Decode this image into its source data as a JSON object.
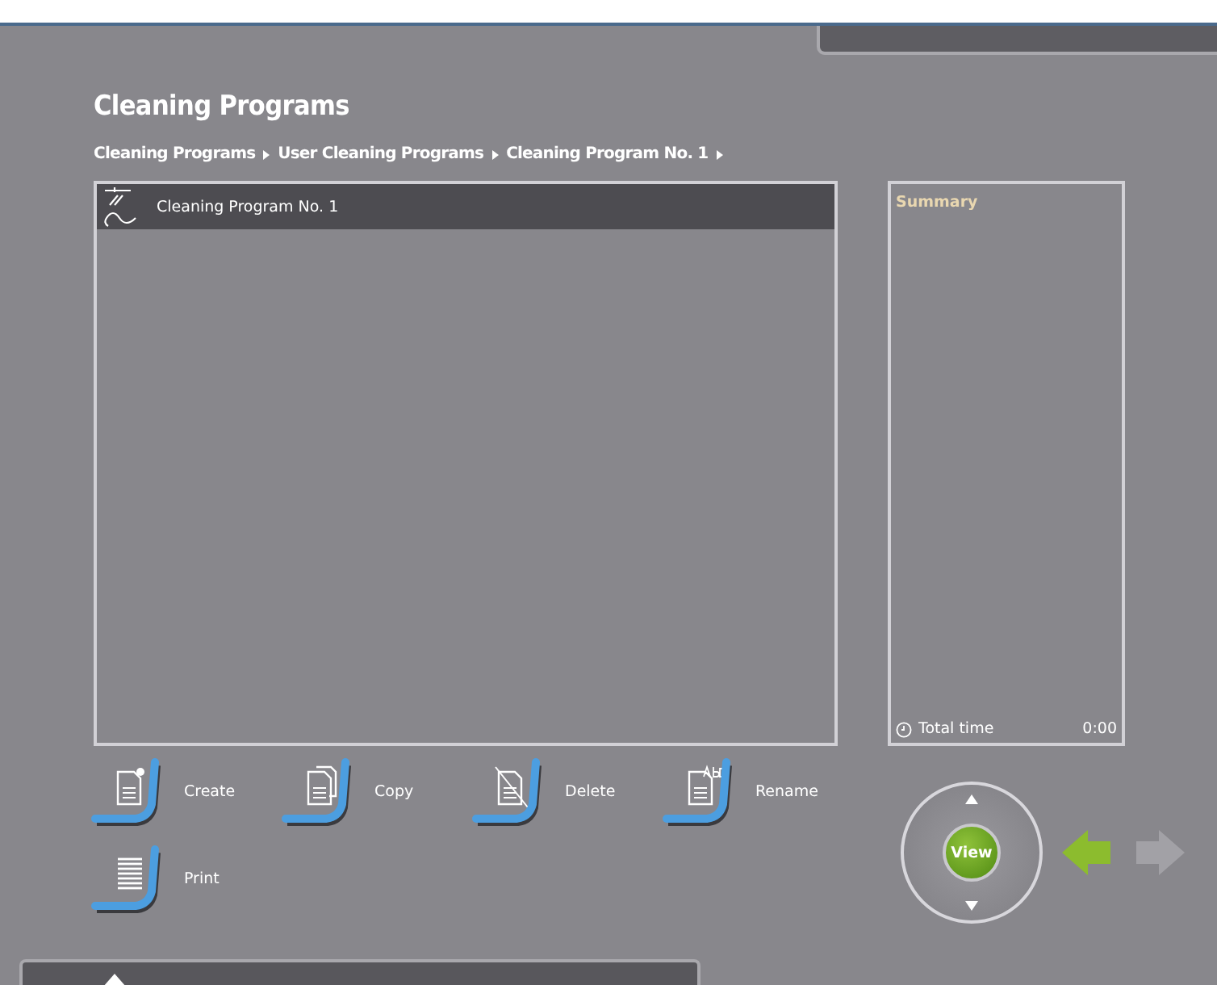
{
  "title": "Cleaning Programs",
  "breadcrumb": [
    "Cleaning Programs",
    "User Cleaning Programs",
    "Cleaning Program No. 1"
  ],
  "programs": [
    {
      "name": "Cleaning Program No. 1",
      "selected": true
    }
  ],
  "summary": {
    "title": "Summary",
    "total_label": "Total time",
    "total_value": "0:00"
  },
  "actions": [
    {
      "kind": "create",
      "label": "Create"
    },
    {
      "kind": "copy",
      "label": "Copy"
    },
    {
      "kind": "delete",
      "label": "Delete"
    },
    {
      "kind": "rename",
      "label": "Rename"
    },
    {
      "kind": "print",
      "label": "Print"
    }
  ],
  "navigator": {
    "center": "View",
    "back_enabled": true,
    "forward_enabled": false
  }
}
